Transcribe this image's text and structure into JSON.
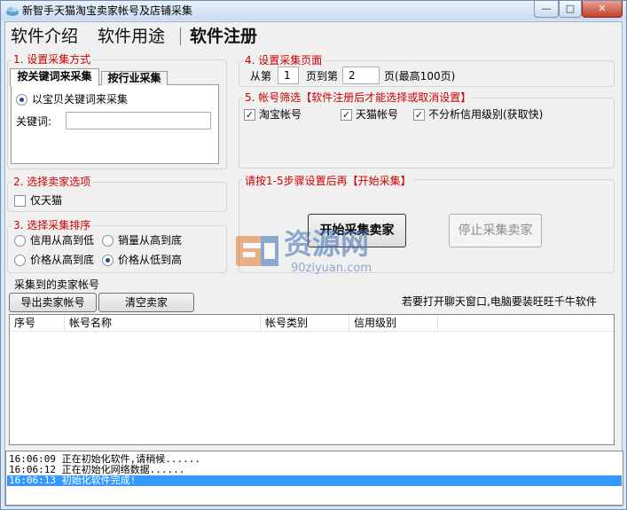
{
  "window": {
    "title": "新智手天猫淘宝卖家帐号及店铺采集",
    "min_glyph": "—",
    "max_glyph": "□",
    "close_glyph": "✕"
  },
  "menu": {
    "items": [
      "软件介绍",
      "软件用途",
      "软件注册"
    ]
  },
  "group1": {
    "title": "1. 设置采集方式",
    "tabs": [
      "按关键词来采集",
      "按行业采集"
    ],
    "radio_label": "以宝贝关键词来采集",
    "keyword_label": "关键词:",
    "keyword_value": ""
  },
  "group2": {
    "title": "2. 选择卖家选项",
    "checkbox_label": "仅天猫"
  },
  "group3": {
    "title": "3. 选择采集排序",
    "options": [
      "信用从高到低",
      "销量从高到底",
      "价格从高到底",
      "价格从低到高"
    ]
  },
  "group4": {
    "title": "4. 设置采集页面",
    "from_label": "从第",
    "from_value": "1",
    "to_label": "页到第",
    "to_value": "2",
    "unit_label": "页(最高100页)"
  },
  "group5": {
    "title": "5. 帐号筛选【软件注册后才能选择或取消设置】",
    "options": [
      "淘宝帐号",
      "天猫帐号",
      "不分析信用级别(获取快)"
    ]
  },
  "action": {
    "prompt": "请按1-5步骤设置后再【开始采集】",
    "start_label": "开始采集卖家",
    "stop_label": "停止采集卖家"
  },
  "watermark": {
    "text_cn": "资源网",
    "text_url": "90ziyuan.com"
  },
  "result": {
    "title": "采集到的卖家帐号",
    "export_label": "导出卖家帐号",
    "clear_label": "清空卖家",
    "note": "若要打开聊天窗口,电脑要装旺旺千牛软件",
    "columns": [
      "序号",
      "帐号名称",
      "帐号类别",
      "信用级别"
    ]
  },
  "log": {
    "lines": [
      {
        "time": "16:06:09",
        "text": "正在初始化软件,请稍候......"
      },
      {
        "time": "16:06:12",
        "text": "正在初始化网络数据......"
      },
      {
        "time": "16:06:13",
        "text": "初始化软件完成!"
      }
    ]
  },
  "colors": {
    "accent_red": "#c00000",
    "selection": "#3399ff",
    "title_bar": "#c9dbf0"
  }
}
